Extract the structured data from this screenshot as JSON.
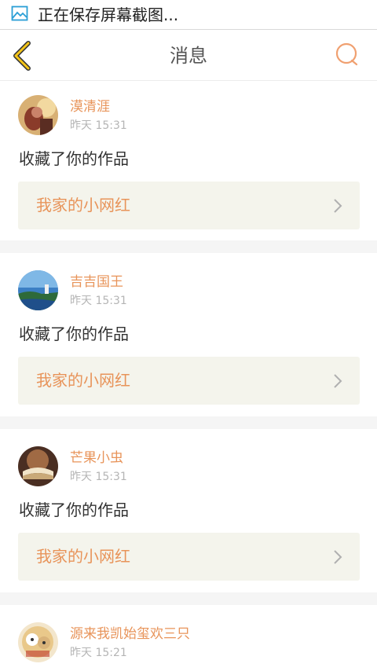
{
  "status_bar": {
    "icon": "screenshot-icon",
    "text": "正在保存屏幕截图..."
  },
  "header": {
    "title": "消息",
    "back_icon": "chevron-left-icon",
    "search_icon": "search-icon",
    "accent": "#f5a623"
  },
  "messages": [
    {
      "name": "漠清涯",
      "time": "昨天 15:31",
      "action": "收藏了你的作品",
      "work": "我家的小网红"
    },
    {
      "name": "吉吉国王",
      "time": "昨天 15:31",
      "action": "收藏了你的作品",
      "work": "我家的小网红"
    },
    {
      "name": "芒果小虫",
      "time": "昨天 15:31",
      "action": "收藏了你的作品",
      "work": "我家的小网红"
    },
    {
      "name": "源来我凯始玺欢三只",
      "time": "昨天 15:21"
    }
  ],
  "colors": {
    "name": "#e8945a",
    "work_bg": "#f4f4ec",
    "separator": "#f5f5f5"
  }
}
